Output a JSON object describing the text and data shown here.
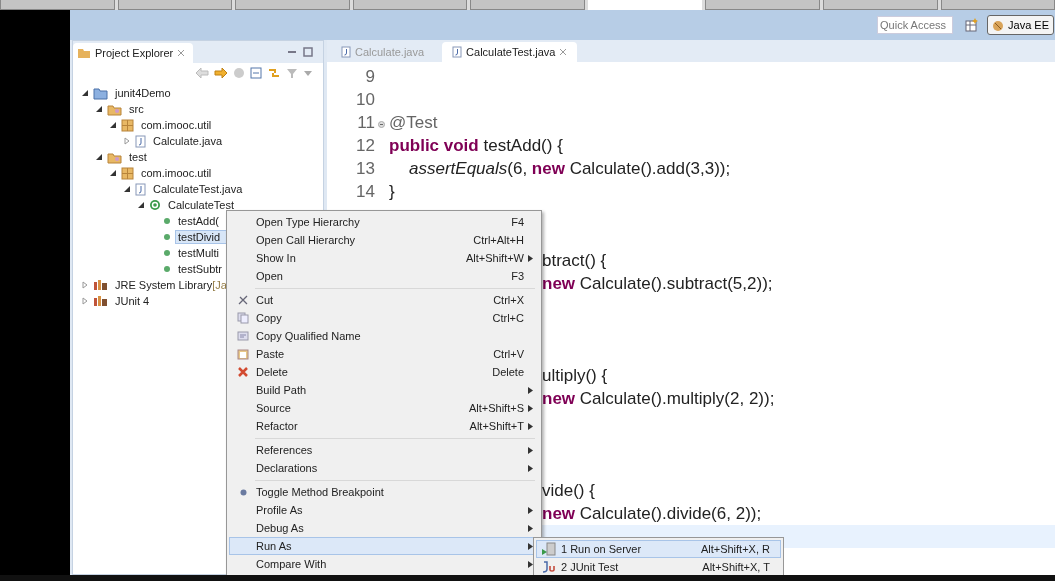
{
  "browser_tabs": [
    {
      "selected": false
    },
    {
      "selected": false
    },
    {
      "selected": false
    },
    {
      "selected": false
    },
    {
      "selected": false
    },
    {
      "selected": true
    },
    {
      "selected": false
    },
    {
      "selected": false
    },
    {
      "selected": false
    }
  ],
  "toolbar": {
    "quick_access": {
      "placeholder": "Quick Access"
    },
    "perspective": {
      "label": "Java EE",
      "selected": true
    }
  },
  "project_explorer": {
    "title": "Project Explorer",
    "tree": [
      {
        "label": "junit4Demo",
        "kind": "project",
        "expanded": true,
        "selected": false,
        "children": [
          {
            "label": "src",
            "kind": "source-folder",
            "expanded": true,
            "selected": false,
            "children": [
              {
                "label": "com.imooc.util",
                "kind": "package",
                "expanded": true,
                "selected": false,
                "children": [
                  {
                    "label": "Calculate.java",
                    "kind": "java-file",
                    "expanded": false,
                    "selected": false
                  }
                ]
              }
            ]
          },
          {
            "label": "test",
            "kind": "source-folder",
            "expanded": true,
            "selected": false,
            "children": [
              {
                "label": "com.imooc.util",
                "kind": "package",
                "expanded": true,
                "selected": false,
                "children": [
                  {
                    "label": "CalculateTest.java",
                    "kind": "java-file",
                    "expanded": true,
                    "selected": false,
                    "children": [
                      {
                        "label": "CalculateTest",
                        "kind": "class",
                        "expanded": true,
                        "selected": false,
                        "children": [
                          {
                            "label": "testAdd(",
                            "kind": "method",
                            "selected": false
                          },
                          {
                            "label": "testDivid",
                            "kind": "method",
                            "selected": true
                          },
                          {
                            "label": "testMulti",
                            "kind": "method",
                            "selected": false
                          },
                          {
                            "label": "testSubtr",
                            "kind": "method",
                            "selected": false
                          }
                        ]
                      }
                    ]
                  }
                ]
              }
            ]
          }
        ]
      },
      {
        "label": "JRE System Library",
        "decoration": "[Ja",
        "kind": "library",
        "expanded": false,
        "selected": false
      },
      {
        "label": "JUnit 4",
        "kind": "library",
        "expanded": false,
        "selected": false
      }
    ]
  },
  "editor": {
    "tabs": [
      {
        "label": "Calculate.java",
        "selected": false
      },
      {
        "label": "CalculateTest.java",
        "selected": true
      }
    ],
    "lines": [
      {
        "number": "9",
        "current": false
      },
      {
        "number": "10",
        "current": false
      },
      {
        "number": "11",
        "fold": true,
        "current": false,
        "segments": [
          {
            "kind": "annotation",
            "text": "@Test"
          }
        ]
      },
      {
        "number": "12",
        "current": false,
        "segments": [
          {
            "kind": "keyword",
            "text": "public void"
          },
          {
            "kind": "plain",
            "text": " testAdd() {"
          }
        ]
      },
      {
        "number": "13",
        "current": false,
        "indented": true,
        "segments": [
          {
            "kind": "static",
            "text": "assertEquals"
          },
          {
            "kind": "plain",
            "text": "(6, "
          },
          {
            "kind": "keyword",
            "text": "new"
          },
          {
            "kind": "plain",
            "text": " Calculate().add(3,3));"
          }
        ]
      },
      {
        "number": "14",
        "current": false,
        "segments": [
          {
            "kind": "plain",
            "text": "}"
          }
        ]
      },
      {
        "current": false
      },
      {
        "current": false
      },
      {
        "current": false,
        "partial": true,
        "segments": [
          {
            "kind": "plain",
            "text": "btract() {"
          }
        ]
      },
      {
        "current": false,
        "partial": true,
        "segments": [
          {
            "kind": "keyword",
            "text": "new"
          },
          {
            "kind": "plain",
            "text": " Calculate().subtract(5,2));"
          }
        ]
      },
      {
        "current": false
      },
      {
        "current": false
      },
      {
        "current": false
      },
      {
        "current": false,
        "partial": true,
        "segments": [
          {
            "kind": "plain",
            "text": "ultiply() {"
          }
        ]
      },
      {
        "current": false,
        "partial": true,
        "segments": [
          {
            "kind": "keyword",
            "text": "new"
          },
          {
            "kind": "plain",
            "text": " Calculate().multiply(2, 2));"
          }
        ]
      },
      {
        "current": false
      },
      {
        "current": false
      },
      {
        "current": false
      },
      {
        "current": false,
        "partial": true,
        "segments": [
          {
            "kind": "plain",
            "text": "vide() {"
          }
        ]
      },
      {
        "current": false,
        "partial": true,
        "segments": [
          {
            "kind": "keyword",
            "text": "new"
          },
          {
            "kind": "plain",
            "text": " Calculate().divide(6, 2));"
          }
        ]
      },
      {
        "current": true
      },
      {
        "current": false
      }
    ]
  },
  "context_menu": {
    "groups": [
      [
        {
          "label": "Open Type Hierarchy",
          "kind": "plain",
          "shortcut": "F4",
          "submenu": false,
          "selected": false
        },
        {
          "label": "Open Call Hierarchy",
          "kind": "plain",
          "shortcut": "Ctrl+Alt+H",
          "submenu": false,
          "selected": false
        },
        {
          "label": "Show In",
          "kind": "plain",
          "shortcut": "Alt+Shift+W",
          "submenu": true,
          "selected": false
        },
        {
          "label": "Open",
          "kind": "plain",
          "shortcut": "F3",
          "submenu": false,
          "selected": false
        }
      ],
      [
        {
          "label": "Cut",
          "kind": "cut",
          "shortcut": "Ctrl+X",
          "submenu": false,
          "selected": false
        },
        {
          "label": "Copy",
          "kind": "copy",
          "shortcut": "Ctrl+C",
          "submenu": false,
          "selected": false
        },
        {
          "label": "Copy Qualified Name",
          "kind": "copy-name",
          "submenu": false,
          "selected": false
        },
        {
          "label": "Paste",
          "kind": "paste",
          "shortcut": "Ctrl+V",
          "submenu": false,
          "selected": false
        },
        {
          "label": "Delete",
          "kind": "delete",
          "shortcut": "Delete",
          "submenu": false,
          "selected": false
        },
        {
          "label": "Build Path",
          "kind": "plain",
          "submenu": true,
          "selected": false
        },
        {
          "label": "Source",
          "kind": "plain",
          "shortcut": "Alt+Shift+S",
          "submenu": true,
          "selected": false
        },
        {
          "label": "Refactor",
          "kind": "plain",
          "shortcut": "Alt+Shift+T",
          "submenu": true,
          "selected": false
        }
      ],
      [
        {
          "label": "References",
          "kind": "plain",
          "submenu": true,
          "selected": false
        },
        {
          "label": "Declarations",
          "kind": "plain",
          "submenu": true,
          "selected": false
        }
      ],
      [
        {
          "label": "Toggle Method Breakpoint",
          "kind": "breakpoint",
          "submenu": false,
          "selected": false
        },
        {
          "label": "Profile As",
          "kind": "plain",
          "submenu": true,
          "selected": false
        },
        {
          "label": "Debug As",
          "kind": "plain",
          "submenu": true,
          "selected": false
        },
        {
          "label": "Run As",
          "kind": "plain",
          "submenu": true,
          "selected": true
        },
        {
          "label": "Compare With",
          "kind": "plain",
          "submenu": true,
          "selected": false
        }
      ]
    ]
  },
  "submenu": [
    {
      "label": "1 Run on Server",
      "kind": "server",
      "shortcut": "Alt+Shift+X, R",
      "selected": true
    },
    {
      "label": "2 JUnit Test",
      "kind": "junit",
      "shortcut": "Alt+Shift+X, T",
      "selected": false
    }
  ]
}
